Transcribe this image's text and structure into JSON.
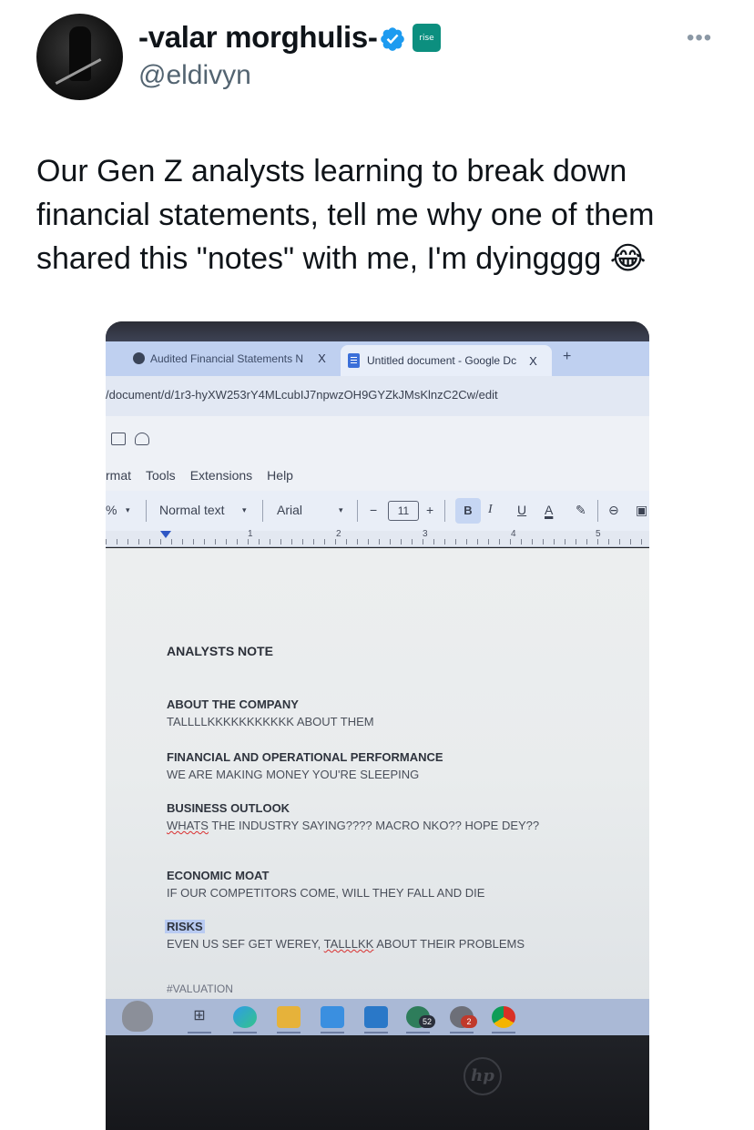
{
  "tweet": {
    "author_name": "-valar morghulis-",
    "handle": "@eldivyn",
    "affiliate_badge": "rise",
    "more_icon": "more-horizontal-icon",
    "text": "Our Gen Z analysts learning to break down financial statements, tell me why one of them shared this \"notes\" with me, I'm dyingggg",
    "emoji": "😂"
  },
  "photo": {
    "browser": {
      "tab1_title": "Audited Financial Statements N",
      "tab1_close": "X",
      "tab2_title": "Untitled document - Google Dc",
      "tab2_close": "X",
      "new_tab": "+",
      "url": "/document/d/1r3-hyXW253rY4MLcubIJ7npwzOH9GYZkJMsKlnzC2Cw/edit"
    },
    "docs": {
      "menu": [
        "rmat",
        "Tools",
        "Extensions",
        "Help"
      ],
      "toolbar": {
        "zoom": "%",
        "style": "Normal text",
        "font": "Arial",
        "minus": "−",
        "font_size": "11",
        "plus": "+",
        "bold": "B",
        "italic": "I",
        "underline": "U",
        "text_color": "A"
      },
      "ruler_numbers": [
        "1",
        "2",
        "3",
        "4",
        "5"
      ]
    },
    "note": {
      "title": "ANALYSTS NOTE",
      "sections": [
        {
          "heading": "ABOUT THE COMPANY",
          "body": "TALLLLKKKKKKKKKKK ABOUT THEM"
        },
        {
          "heading": "FINANCIAL AND OPERATIONAL PERFORMANCE",
          "body": "WE ARE MAKING MONEY YOU'RE SLEEPING"
        },
        {
          "heading": "BUSINESS OUTLOOK",
          "body_spell": "WHATS",
          "body": " THE INDUSTRY SAYING???? MACRO NKO?? HOPE DEY??"
        },
        {
          "heading": "ECONOMIC MOAT",
          "body": "IF OUR COMPETITORS COME, WILL THEY FALL AND DIE"
        },
        {
          "heading": "RISKS",
          "body": "EVEN US SEF GET WEREY, ",
          "body_spell": "TALLLKK",
          "body_tail": " ABOUT THEIR PROBLEMS"
        }
      ],
      "valuation": "#VALUATION"
    },
    "taskbar": {
      "mail_badge": "52",
      "chat_badge": "2"
    },
    "laptop_logo": "hp"
  },
  "colors": {
    "verified": "#1d9bf0",
    "rise_badge": "#0c8f7f",
    "docs_blue": "#3b6fd8"
  }
}
